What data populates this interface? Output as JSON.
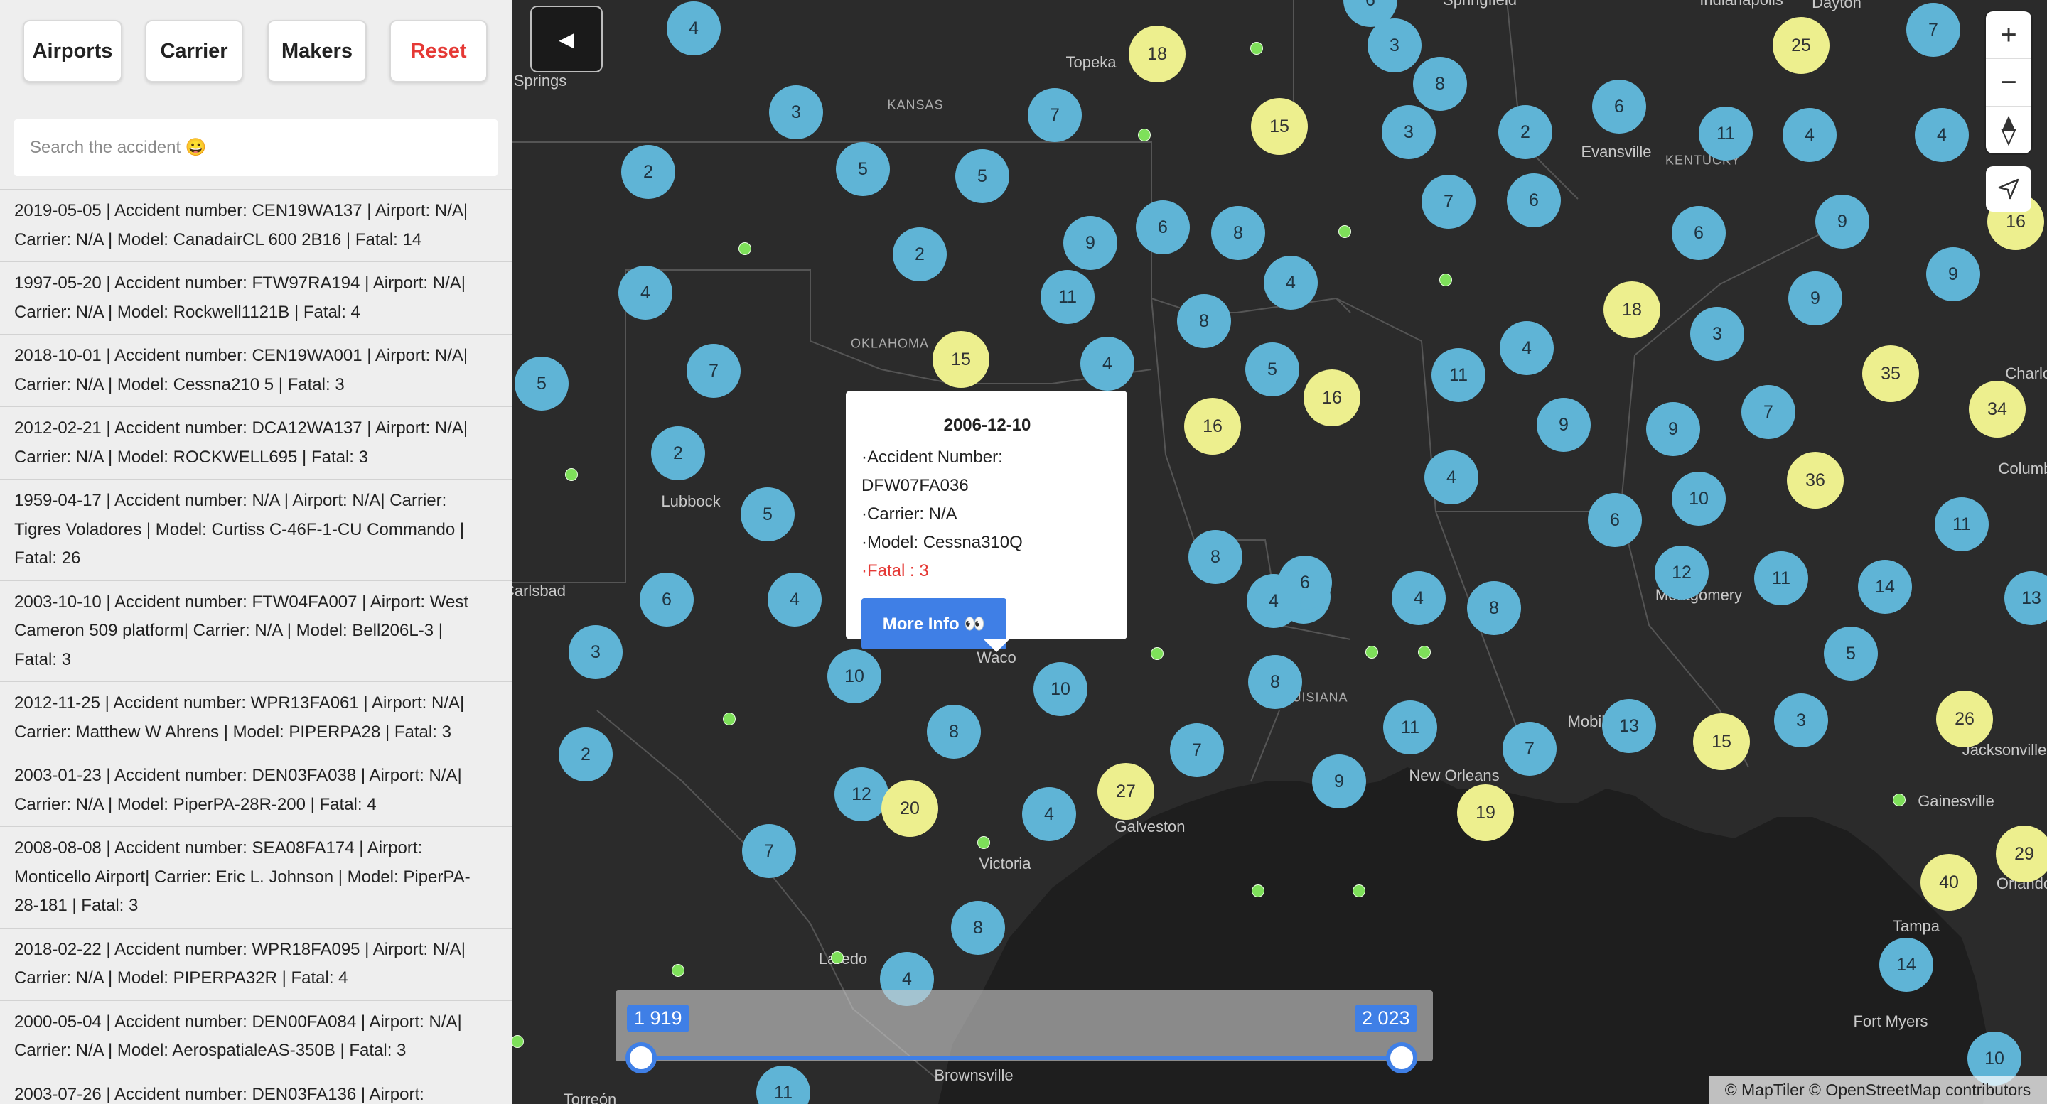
{
  "sidebar": {
    "buttons": {
      "airports": "Airports",
      "carrier": "Carrier",
      "makers": "Makers",
      "reset": "Reset"
    },
    "search_placeholder": "Search the accident 😀",
    "accidents": [
      "2019-05-05 | Accident number: CEN19WA137 | Airport: N/A| Carrier: N/A | Model: CanadairCL 600 2B16 | Fatal: 14",
      "1997-05-20 | Accident number: FTW97RA194 | Airport: N/A| Carrier: N/A | Model: Rockwell1121B | Fatal: 4",
      "2018-10-01 | Accident number: CEN19WA001 | Airport: N/A| Carrier: N/A | Model: Cessna210 5 | Fatal: 3",
      "2012-02-21 | Accident number: DCA12WA137 | Airport: N/A| Carrier: N/A | Model: ROCKWELL695 | Fatal: 3",
      "1959-04-17 | Accident number: N/A | Airport: N/A| Carrier: Tigres Voladores | Model: Curtiss C-46F-1-CU Commando | Fatal: 26",
      "2003-10-10 | Accident number: FTW04FA007 | Airport: West Cameron 509 platform| Carrier: N/A | Model: Bell206L-3 | Fatal: 3",
      "2012-11-25 | Accident number: WPR13FA061 | Airport: N/A| Carrier: Matthew W Ahrens | Model: PIPERPA28 | Fatal: 3",
      "2003-01-23 | Accident number: DEN03FA038 | Airport: N/A| Carrier: N/A | Model: PiperPA-28R-200 | Fatal: 4",
      "2008-08-08 | Accident number: SEA08FA174 | Airport: Monticello Airport| Carrier: Eric L. Johnson | Model: PiperPA-28-181 | Fatal: 3",
      "2018-02-22 | Accident number: WPR18FA095 | Airport: N/A| Carrier: N/A | Model: PIPERPA32R | Fatal: 4",
      "2000-05-04 | Accident number: DEN00FA084 | Airport: N/A| Carrier: N/A | Model: AerospatialeAS-350B | Fatal: 3",
      "2003-07-26 | Accident number: DEN03FA136 | Airport:"
    ]
  },
  "map": {
    "collapse_icon": "◀",
    "zoom_in": "+",
    "zoom_out": "−",
    "compass_icon": "compass-icon",
    "geolocate_icon": "geolocate-icon",
    "attribution": "© MapTiler © OpenStreetMap contributors",
    "place_labels": [
      "Springs",
      "Topeka",
      "KANSAS",
      "Evansville",
      "KENTUCKY",
      "OKLAHOMA",
      "Lubbock",
      "Carlsbad",
      "Waco",
      "LOUISIANA",
      "Montgomery",
      "Mobile",
      "New Orleans",
      "Galveston",
      "Victoria",
      "Gainesville",
      "Jacksonville",
      "Orlando",
      "Tampa",
      "Fort Myers",
      "Laredo",
      "Brownsville",
      "Torreón",
      "Columbia",
      "Charlotte",
      "Springfield",
      "Indianapolis",
      "Dayton"
    ],
    "clusters": [
      {
        "n": "4",
        "c": "b"
      },
      {
        "n": "6",
        "c": "b"
      },
      {
        "n": "18",
        "c": "y"
      },
      {
        "n": "3",
        "c": "b"
      },
      {
        "n": "25",
        "c": "y"
      },
      {
        "n": "7",
        "c": "b"
      },
      {
        "n": "3",
        "c": "b"
      },
      {
        "n": "7",
        "c": "b"
      },
      {
        "n": "15",
        "c": "y"
      },
      {
        "n": "8",
        "c": "b"
      },
      {
        "n": "3",
        "c": "b"
      },
      {
        "n": "2",
        "c": "b"
      },
      {
        "n": "6",
        "c": "b"
      },
      {
        "n": "11",
        "c": "b"
      },
      {
        "n": "4",
        "c": "b"
      },
      {
        "n": "4",
        "c": "b"
      },
      {
        "n": "2",
        "c": "b"
      },
      {
        "n": "5",
        "c": "b"
      },
      {
        "n": "5",
        "c": "b"
      },
      {
        "n": "7",
        "c": "b"
      },
      {
        "n": "6",
        "c": "b"
      },
      {
        "n": "6",
        "c": "b"
      },
      {
        "n": "9",
        "c": "b"
      },
      {
        "n": "16",
        "c": "y"
      },
      {
        "n": "2",
        "c": "b"
      },
      {
        "n": "9",
        "c": "b"
      },
      {
        "n": "6",
        "c": "b"
      },
      {
        "n": "8",
        "c": "b"
      },
      {
        "n": "4",
        "c": "b"
      },
      {
        "n": "11",
        "c": "b"
      },
      {
        "n": "9",
        "c": "b"
      },
      {
        "n": "4",
        "c": "b"
      },
      {
        "n": "8",
        "c": "b"
      },
      {
        "n": "18",
        "c": "y"
      },
      {
        "n": "3",
        "c": "b"
      },
      {
        "n": "9",
        "c": "b"
      },
      {
        "n": "5",
        "c": "b"
      },
      {
        "n": "7",
        "c": "b"
      },
      {
        "n": "15",
        "c": "y"
      },
      {
        "n": "4",
        "c": "b"
      },
      {
        "n": "5",
        "c": "b"
      },
      {
        "n": "16",
        "c": "y"
      },
      {
        "n": "11",
        "c": "b"
      },
      {
        "n": "4",
        "c": "b"
      },
      {
        "n": "35",
        "c": "y"
      },
      {
        "n": "34",
        "c": "y"
      },
      {
        "n": "2",
        "c": "b"
      },
      {
        "n": "16",
        "c": "y"
      },
      {
        "n": "9",
        "c": "b"
      },
      {
        "n": "9",
        "c": "b"
      },
      {
        "n": "7",
        "c": "b"
      },
      {
        "n": "5",
        "c": "b"
      },
      {
        "n": "4",
        "c": "b"
      },
      {
        "n": "36",
        "c": "y"
      },
      {
        "n": "6",
        "c": "b"
      },
      {
        "n": "10",
        "c": "b"
      },
      {
        "n": "11",
        "c": "b"
      },
      {
        "n": "6",
        "c": "b"
      },
      {
        "n": "4",
        "c": "b"
      },
      {
        "n": "8",
        "c": "b"
      },
      {
        "n": "4",
        "c": "b"
      },
      {
        "n": "6",
        "c": "b"
      },
      {
        "n": "4",
        "c": "b"
      },
      {
        "n": "8",
        "c": "b"
      },
      {
        "n": "12",
        "c": "b"
      },
      {
        "n": "11",
        "c": "b"
      },
      {
        "n": "14",
        "c": "b"
      },
      {
        "n": "13",
        "c": "b"
      },
      {
        "n": "3",
        "c": "b"
      },
      {
        "n": "10",
        "c": "b"
      },
      {
        "n": "10",
        "c": "b"
      },
      {
        "n": "8",
        "c": "b"
      },
      {
        "n": "4",
        "c": "b"
      },
      {
        "n": "5",
        "c": "b"
      },
      {
        "n": "2",
        "c": "b"
      },
      {
        "n": "8",
        "c": "b"
      },
      {
        "n": "11",
        "c": "b"
      },
      {
        "n": "13",
        "c": "b"
      },
      {
        "n": "15",
        "c": "y"
      },
      {
        "n": "3",
        "c": "b"
      },
      {
        "n": "26",
        "c": "y"
      },
      {
        "n": "12",
        "c": "b"
      },
      {
        "n": "20",
        "c": "y"
      },
      {
        "n": "27",
        "c": "y"
      },
      {
        "n": "4",
        "c": "b"
      },
      {
        "n": "7",
        "c": "b"
      },
      {
        "n": "9",
        "c": "b"
      },
      {
        "n": "19",
        "c": "y"
      },
      {
        "n": "7",
        "c": "b"
      },
      {
        "n": "7",
        "c": "b"
      },
      {
        "n": "40",
        "c": "y"
      },
      {
        "n": "29",
        "c": "y"
      },
      {
        "n": "8",
        "c": "b"
      },
      {
        "n": "4",
        "c": "b"
      },
      {
        "n": "14",
        "c": "b"
      },
      {
        "n": "10",
        "c": "b"
      },
      {
        "n": "11",
        "c": "b"
      }
    ]
  },
  "popup": {
    "date": "2006-12-10",
    "accident_number": "·Accident Number: DFW07FA036",
    "carrier": "·Carrier: N/A",
    "model": "·Model: Cessna310Q",
    "fatal": "·Fatal : 3",
    "more_info": "More Info 👀"
  },
  "slider": {
    "min_label": "1 919",
    "max_label": "2 023"
  }
}
